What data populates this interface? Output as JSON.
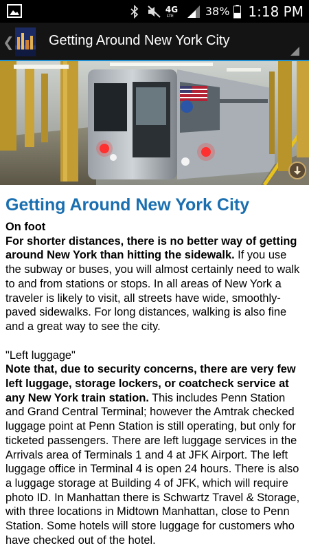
{
  "status_bar": {
    "icons": [
      "gallery-icon",
      "bluetooth-icon",
      "mute-icon",
      "4g-lte-icon",
      "signal-icon",
      "battery-icon"
    ],
    "network_label": "4G",
    "battery": "38%",
    "time": "1:18 PM"
  },
  "action_bar": {
    "title": "Getting Around New York City"
  },
  "article": {
    "title": "Getting Around New York City",
    "sections": [
      {
        "heading": "On foot",
        "lead": "For shorter distances, there is no better way of getting around New York than hitting the sidewalk.",
        "body": " If you use the subway or buses, you will almost certainly need to walk to and from stations or stops. In all areas of New York a traveler is likely to visit, all streets have wide, smoothly-paved sidewalks. For long distances, walking is also fine and a great way to see the city."
      },
      {
        "heading": "\"Left luggage\"",
        "lead": "Note that, due to security concerns, there are very few left luggage, storage lockers, or coatcheck service at any New York train station.",
        "body": " This includes Penn Station and Grand Central Terminal; however the Amtrak checked luggage point at Penn Station is still operating, but only for ticketed passengers. There are left luggage services in the Arrivals area of Terminals 1 and 4 at JFK Airport. The left luggage office in Terminal 4 is open 24 hours. There is also a luggage storage at Building 4 of JFK, which will require photo ID. In Manhattan there is Schwartz Travel & Storage, with three locations in Midtown Manhattan, close to Penn Station. Some hotels will store luggage for customers who have checked out of the hotel."
      }
    ]
  },
  "colors": {
    "title_blue": "#1a6fb0",
    "action_bar_accent": "#1e8fd0"
  }
}
